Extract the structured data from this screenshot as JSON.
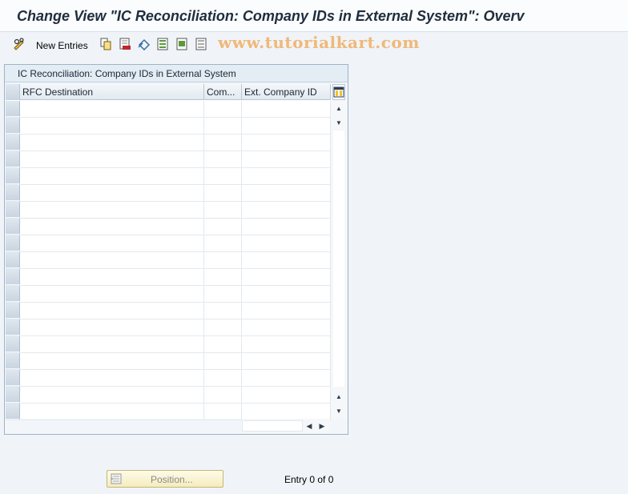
{
  "window": {
    "title": "Change View \"IC Reconciliation: Company IDs in External System\": Overv"
  },
  "toolbar": {
    "edit_icon": "glasses-pencil-icon",
    "new_entries_label": "New Entries",
    "icons": [
      "copy-icon",
      "delete-icon",
      "undo-icon",
      "select-all-icon",
      "select-block-icon",
      "deselect-all-icon"
    ]
  },
  "watermark": "www.tutorialkart.com",
  "table": {
    "title": "IC Reconciliation: Company IDs in External System",
    "columns": [
      "RFC Destination",
      "Com...",
      "Ext. Company ID"
    ],
    "settings_icon": "table-settings-icon",
    "row_count_visible": 19
  },
  "footer": {
    "position_button_label": "Position...",
    "entry_info": "Entry 0 of 0"
  },
  "colors": {
    "title_text": "#1f2d3d",
    "panel_border": "#9fb3c8",
    "watermark": "#f0b878",
    "button_bg": "#f5ecbc"
  }
}
